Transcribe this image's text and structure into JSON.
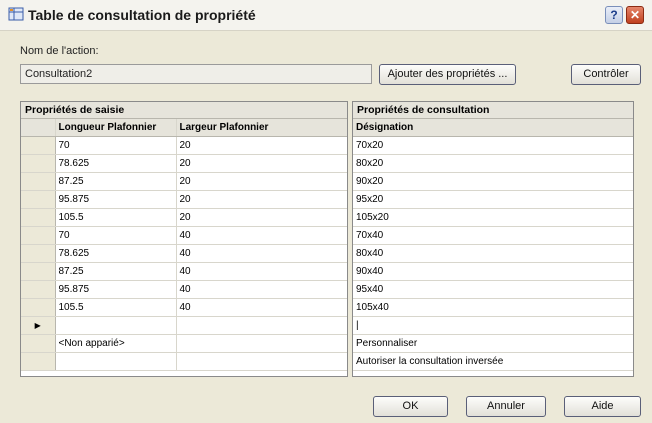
{
  "window": {
    "title": "Table de consultation de propriété",
    "help": "?",
    "close": "✕"
  },
  "action_name": {
    "label": "Nom de l'action:",
    "value": "Consultation2"
  },
  "buttons": {
    "add_properties": "Ajouter des propriétés ...",
    "control": "Contrôler",
    "ok": "OK",
    "cancel": "Annuler",
    "help": "Aide"
  },
  "input_properties": {
    "title": "Propriétés de saisie",
    "headers": [
      "Longueur Plafonnier",
      "Largeur Plafonnier"
    ],
    "rows": [
      [
        "70",
        "20"
      ],
      [
        "78.625",
        "20"
      ],
      [
        "87.25",
        "20"
      ],
      [
        "95.875",
        "20"
      ],
      [
        "105.5",
        "20"
      ],
      [
        "70",
        "40"
      ],
      [
        "78.625",
        "40"
      ],
      [
        "87.25",
        "40"
      ],
      [
        "95.875",
        "40"
      ],
      [
        "105.5",
        "40"
      ],
      [
        "",
        ""
      ],
      [
        "<Non apparié>",
        ""
      ],
      [
        "",
        ""
      ]
    ],
    "current_row_marker": "▶"
  },
  "lookup_properties": {
    "title": "Propriétés de consultation",
    "header": "Désignation",
    "rows": [
      "70x20",
      "80x20",
      "90x20",
      "95x20",
      "105x20",
      "70x40",
      "80x40",
      "90x40",
      "95x40",
      "105x40",
      "|",
      "Personnaliser",
      "Autoriser la consultation inversée"
    ]
  }
}
